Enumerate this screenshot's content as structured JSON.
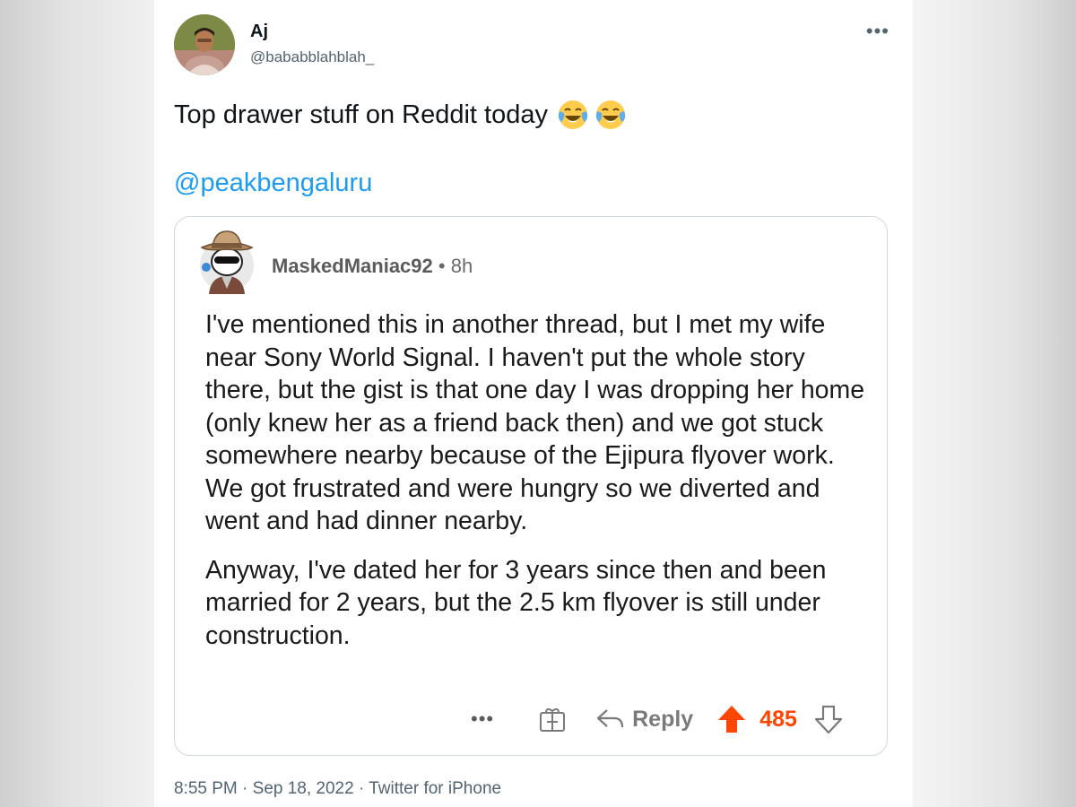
{
  "author": {
    "name": "Aj",
    "handle": "@bababblahblah_"
  },
  "tweet": {
    "text": "Top drawer stuff on Reddit today",
    "emoji": [
      "face-with-tears-of-joy",
      "face-with-tears-of-joy"
    ],
    "mention": "@peakbengaluru"
  },
  "quoted_post": {
    "username": "MaskedManiac92",
    "time": "8h",
    "separator": " • ",
    "paragraphs": [
      "I've mentioned this in another thread, but I met my wife near Sony World Signal. I haven't put the whole story there, but the gist is that one day I was dropping her home (only knew her as a friend back then) and we got stuck somewhere nearby because of the Ejipura flyover work. We got frustrated and were hungry so we diverted and went and had dinner nearby.",
      "Anyway, I've dated her for 3 years since then and been married for 2 years, but the 2.5 km flyover is still under construction."
    ],
    "actions": {
      "more": "•••",
      "reply_label": "Reply",
      "score": "485"
    },
    "colors": {
      "upvote": "#ff4500"
    }
  },
  "meta": {
    "text": "8:55 PM · Sep 18, 2022 · Twitter for iPhone"
  },
  "ui": {
    "more_dots": "•••"
  }
}
